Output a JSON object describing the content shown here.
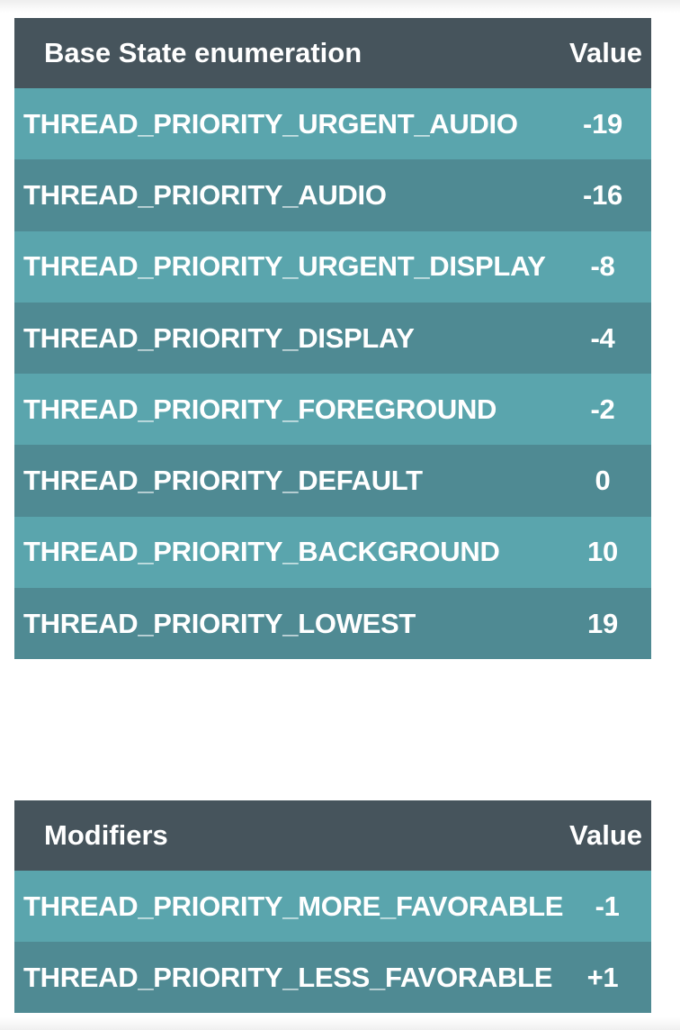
{
  "base_table": {
    "header": {
      "name": "Base State enumeration",
      "value": "Value"
    },
    "rows": [
      {
        "name": "THREAD_PRIORITY_URGENT_AUDIO",
        "value": "-19"
      },
      {
        "name": "THREAD_PRIORITY_AUDIO",
        "value": "-16"
      },
      {
        "name": "THREAD_PRIORITY_URGENT_DISPLAY",
        "value": "-8"
      },
      {
        "name": "THREAD_PRIORITY_DISPLAY",
        "value": "-4"
      },
      {
        "name": "THREAD_PRIORITY_FOREGROUND",
        "value": "-2"
      },
      {
        "name": "THREAD_PRIORITY_DEFAULT",
        "value": "0"
      },
      {
        "name": "THREAD_PRIORITY_BACKGROUND",
        "value": "10"
      },
      {
        "name": "THREAD_PRIORITY_LOWEST",
        "value": "19"
      }
    ]
  },
  "modifiers_table": {
    "header": {
      "name": "Modifiers",
      "value": "Value"
    },
    "rows": [
      {
        "name": "THREAD_PRIORITY_MORE_FAVORABLE",
        "value": "-1"
      },
      {
        "name": "THREAD_PRIORITY_LESS_FAVORABLE",
        "value": "+1"
      }
    ]
  },
  "colors": {
    "header_bg": "#46545c",
    "row_light": "#5aa5ad",
    "row_dark": "#4f8a93",
    "text": "#ffffff"
  }
}
